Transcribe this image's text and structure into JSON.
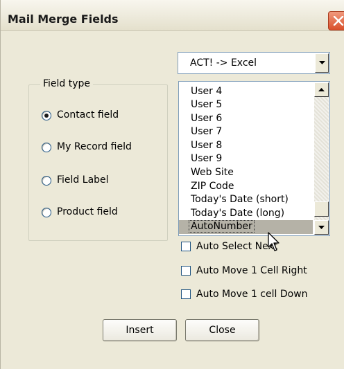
{
  "window": {
    "title": "Mail Merge Fields"
  },
  "mapping": {
    "selected": "ACT! -> Excel"
  },
  "field_type": {
    "label": "Field type",
    "options": [
      {
        "label": "Contact field",
        "selected": true
      },
      {
        "label": "My Record field",
        "selected": false
      },
      {
        "label": "Field Label",
        "selected": false
      },
      {
        "label": "Product field",
        "selected": false
      }
    ]
  },
  "fields": {
    "items": [
      "User 4",
      "User 5",
      "User 6",
      "User 7",
      "User 8",
      "User 9",
      "Web Site",
      "ZIP Code",
      "Today's Date (short)",
      "Today's Date (long)",
      "AutoNumber"
    ],
    "selected": "AutoNumber"
  },
  "options": [
    {
      "label": "Auto Select Next",
      "checked": false
    },
    {
      "label": "Auto Move 1 Cell Right",
      "checked": false
    },
    {
      "label": "Auto Move 1 cell Down",
      "checked": false
    }
  ],
  "buttons": {
    "insert": "Insert",
    "close": "Close"
  },
  "icons": {
    "close": "close-icon",
    "dropdown": "chevron-down-icon",
    "scroll_up": "arrow-up-icon",
    "scroll_down": "arrow-down-icon",
    "cursor": "mouse-cursor-icon"
  }
}
